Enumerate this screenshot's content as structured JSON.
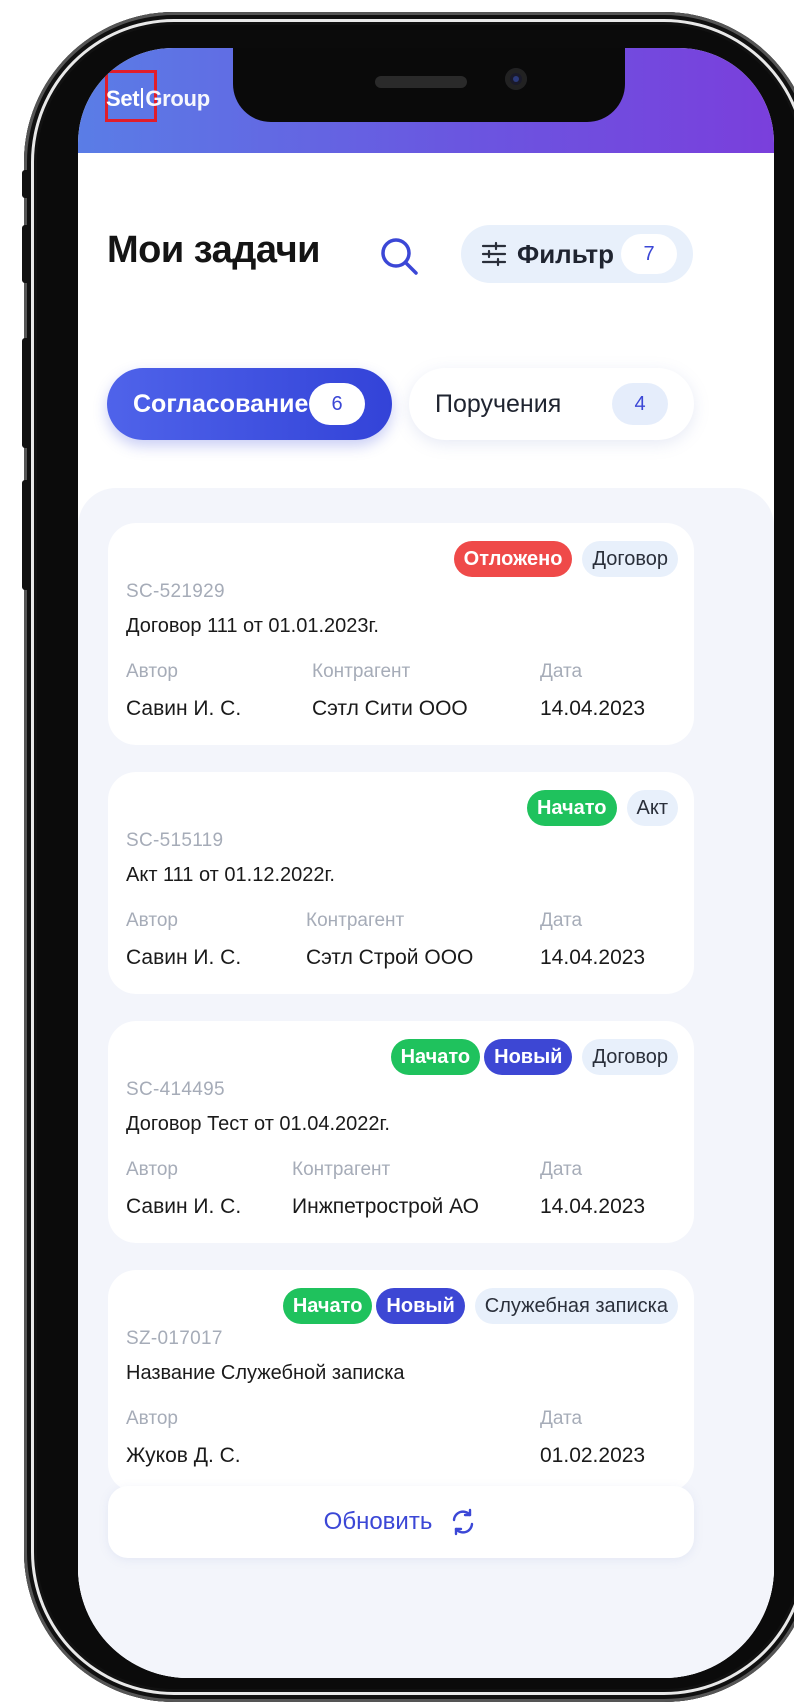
{
  "logo": {
    "text_a": "Set",
    "text_b": "Group"
  },
  "header": {
    "title": "Мои задачи",
    "filter": {
      "label": "Фильтр",
      "count": "7"
    }
  },
  "tabs": [
    {
      "label": "Согласование",
      "count": "6",
      "active": true
    },
    {
      "label": "Поручения",
      "count": "4",
      "active": false
    }
  ],
  "meta_labels": {
    "author": "Автор",
    "counterparty": "Контрагент",
    "date": "Дата"
  },
  "cards": [
    {
      "status_badges": [
        "Отложено"
      ],
      "type": "Договор",
      "code": "SC-521929",
      "title": "Договор 111 от 01.01.2023г.",
      "author": "Савин И. С.",
      "counterparty": "Сэтл Сити ООО",
      "date": "14.04.2023"
    },
    {
      "status_badges": [
        "Начато"
      ],
      "type": "Акт",
      "code": "SC-515119",
      "title": "Акт 111 от 01.12.2022г.",
      "author": "Савин И. С.",
      "counterparty": "Сэтл Строй ООО",
      "date": "14.04.2023"
    },
    {
      "status_badges": [
        "Начато",
        "Новый"
      ],
      "type": "Договор",
      "code": "SC-414495",
      "title": "Договор Тест от 01.04.2022г.",
      "author": "Савин И. С.",
      "counterparty": "Инжпетрострой АО",
      "date": "14.04.2023"
    },
    {
      "status_badges": [
        "Начато",
        "Новый"
      ],
      "type": "Служебная записка",
      "code": "SZ-017017",
      "title": "Название Служебной записка",
      "author": "Жуков Д. С.",
      "counterparty": "",
      "date": "01.02.2023"
    }
  ],
  "refresh": {
    "label": "Обновить"
  },
  "colors": {
    "accent": "#3b47d6",
    "status_red": "#ef4a49",
    "status_green": "#1fc25d",
    "status_blue": "#3d47d4"
  },
  "icons": [
    "search-icon",
    "filter-sliders-icon",
    "refresh-icon"
  ]
}
